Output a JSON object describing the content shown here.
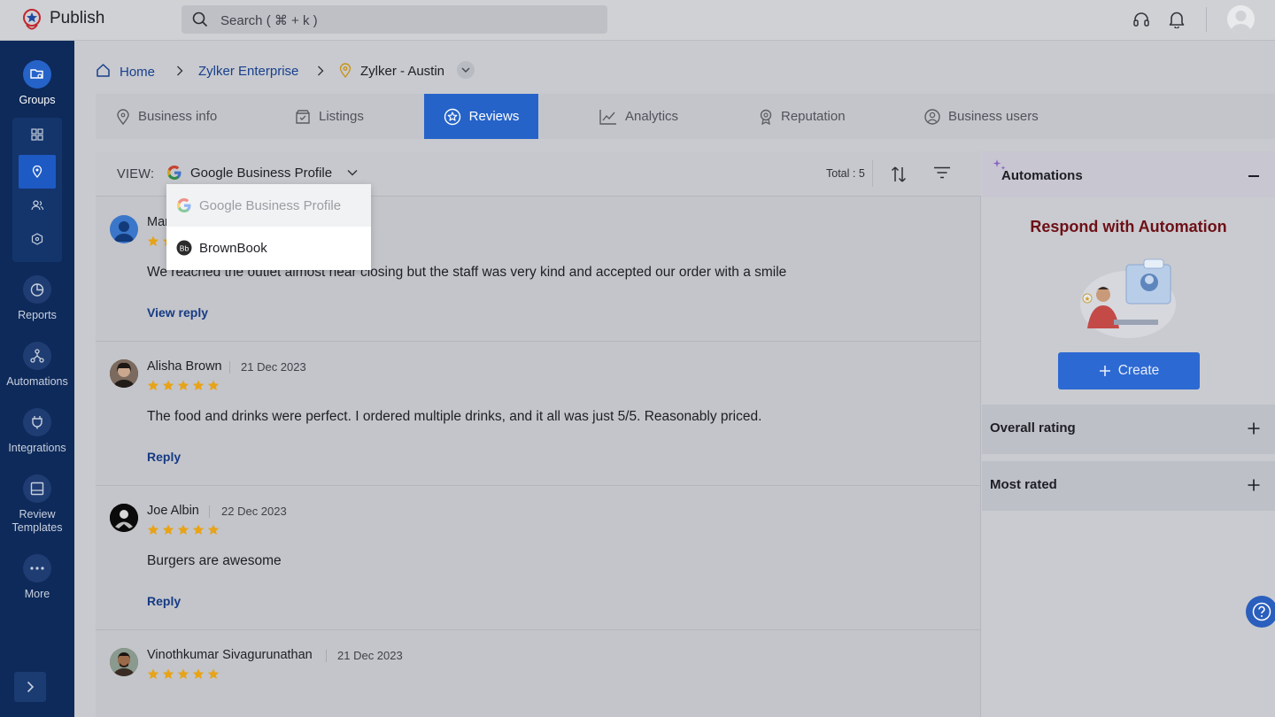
{
  "app": {
    "title": "Publish"
  },
  "search": {
    "placeholder": "Search ( ⌘ + k )"
  },
  "sidebar": {
    "items": [
      {
        "label": "Groups",
        "icon": "groups-icon",
        "active": true
      },
      {
        "label": "Reports",
        "icon": "reports-icon"
      },
      {
        "label": "Automations",
        "icon": "automations-icon"
      },
      {
        "label": "Integrations",
        "icon": "integrations-icon"
      },
      {
        "label": "Review Templates",
        "icon": "review-templates-icon"
      },
      {
        "label": "More",
        "icon": "more-icon"
      }
    ],
    "sub_items": [
      "dashboard-icon",
      "location-icon",
      "users-icon",
      "hexagon-icon"
    ]
  },
  "breadcrumb": {
    "home": "Home",
    "enterprise": "Zylker Enterprise",
    "location": "Zylker - Austin"
  },
  "tabs": [
    {
      "label": "Business info",
      "icon": "location-pin-icon"
    },
    {
      "label": "Listings",
      "icon": "listings-icon"
    },
    {
      "label": "Reviews",
      "icon": "reviews-star-icon",
      "active": true
    },
    {
      "label": "Analytics",
      "icon": "analytics-icon"
    },
    {
      "label": "Reputation",
      "icon": "reputation-icon"
    },
    {
      "label": "Business users",
      "icon": "business-users-icon"
    }
  ],
  "view": {
    "label": "VIEW:",
    "selected": "Google Business Profile",
    "total": "Total : 5"
  },
  "dropdown": {
    "options": [
      {
        "label": "Google Business Profile",
        "selected": true
      },
      {
        "label": "BrownBook",
        "selected": false
      }
    ]
  },
  "reviews": [
    {
      "name": "Mar",
      "date": "",
      "rating": 5,
      "text": "We reached the outlet almost near closing but the staff was very kind and accepted our order with a smile",
      "action": "View reply"
    },
    {
      "name": "Alisha Brown",
      "date": "21 Dec 2023",
      "rating": 5,
      "text": "The food and drinks were perfect. I ordered multiple drinks, and it all was just 5/5. Reasonably priced.",
      "action": "Reply"
    },
    {
      "name": "Joe Albin",
      "date": "22 Dec 2023",
      "rating": 5,
      "text": "Burgers are awesome",
      "action": "Reply"
    },
    {
      "name": "Vinothkumar Sivagurunathan",
      "date": "21 Dec 2023",
      "rating": 5,
      "text": "",
      "action": ""
    }
  ],
  "right_panel": {
    "automations_title": "Automations",
    "respond_title": "Respond with Automation",
    "create_label": "Create",
    "overall_rating": "Overall rating",
    "most_rated": "Most rated"
  },
  "colors": {
    "accent": "#2563c9",
    "sidebar": "#0e2a5a",
    "star": "#e8a317",
    "respond_title": "#6e0f16"
  }
}
